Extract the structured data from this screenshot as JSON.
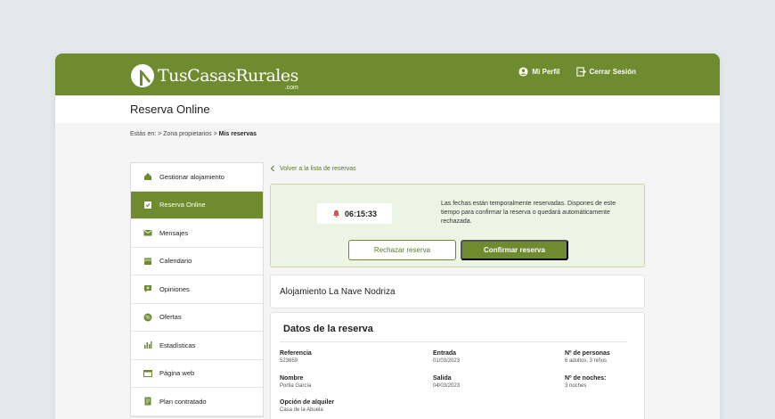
{
  "header": {
    "logo_text": "TusCasasRurales",
    "logo_suffix": ".com",
    "profile_label": "Mi Perfil",
    "logout_label": "Cerrar Sesión"
  },
  "page": {
    "title": "Reserva Online"
  },
  "breadcrumb": {
    "prefix": "Estás en: > Zona propietarios > ",
    "current": "Mis reservas"
  },
  "sidebar": {
    "items": [
      {
        "label": "Gestionar alojamiento",
        "icon": "home-icon"
      },
      {
        "label": "Reserva Online",
        "icon": "calendar-check-icon",
        "active": true
      },
      {
        "label": "Mensajes",
        "icon": "mail-icon"
      },
      {
        "label": "Calendario",
        "icon": "calendar-icon"
      },
      {
        "label": "Opiniones",
        "icon": "comment-icon"
      },
      {
        "label": "Ofertas",
        "icon": "offer-icon"
      },
      {
        "label": "Estadísticas",
        "icon": "stats-icon"
      },
      {
        "label": "Página web",
        "icon": "web-icon"
      },
      {
        "label": "Plan contratado",
        "icon": "plan-icon"
      }
    ]
  },
  "main": {
    "back_label": "Volver a la lista de reservas",
    "timer": {
      "time": "06:15:33",
      "message": "Las fechas están temporalmente reservadas. Dispones de este tiempo para confirmar la reserva o quedará automáticamente rechazada.",
      "reject_label": "Rechazar reserva",
      "confirm_label": "Confirmar reserva"
    },
    "property_name": "Alojamiento La Nave Nodriza",
    "details": {
      "title": "Datos de la reserva",
      "referencia_label": "Referencia",
      "referencia_value": "523659",
      "entrada_label": "Entrada",
      "entrada_value": "01/03/2023",
      "personas_label": "Nº de personas",
      "personas_value": "6 adultos, 3 niños",
      "nombre_label": "Nombre",
      "nombre_value": "Portia García",
      "salida_label": "Salida",
      "salida_value": "04/03/2023",
      "noches_label": "Nº de noches:",
      "noches_value": "3 noches",
      "opcion_label": "Opción de alquiler",
      "opcion_value": "Casa de la Abuela"
    }
  },
  "colors": {
    "brand": "#6e8b2f",
    "timer_bg": "#eef4e4",
    "alert": "#d9534f"
  }
}
